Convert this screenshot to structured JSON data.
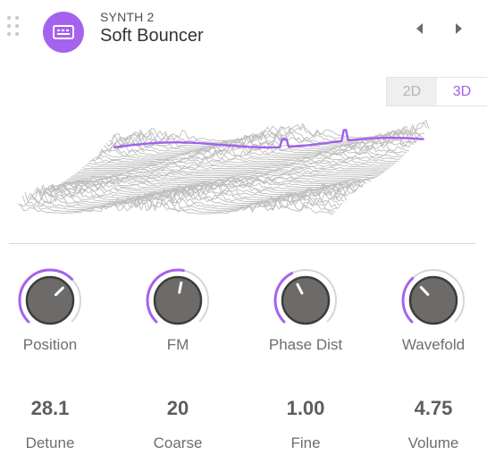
{
  "header": {
    "subtitle": "SYNTH 2",
    "title": "Soft Bouncer",
    "accent_color": "#a562ef",
    "icons": [
      "drag-handle-icon",
      "synth-module-icon",
      "previous-arrow-icon",
      "next-arrow-icon"
    ]
  },
  "view_toggle": {
    "options": [
      "2D",
      "3D"
    ],
    "selected": "3D"
  },
  "waveform": {
    "mode": "3D",
    "highlight_color": "#a260ec"
  },
  "knobs": [
    {
      "label": "Position",
      "fraction": 0.67
    },
    {
      "label": "FM",
      "fraction": 0.54
    },
    {
      "label": "Phase Dist",
      "fraction": 0.4
    },
    {
      "label": "Wavefold",
      "fraction": 0.34
    }
  ],
  "params": [
    {
      "value": "28.1",
      "label": "Detune"
    },
    {
      "value": "20",
      "label": "Coarse"
    },
    {
      "value": "1.00",
      "label": "Fine"
    },
    {
      "value": "4.75",
      "label": "Volume"
    }
  ]
}
